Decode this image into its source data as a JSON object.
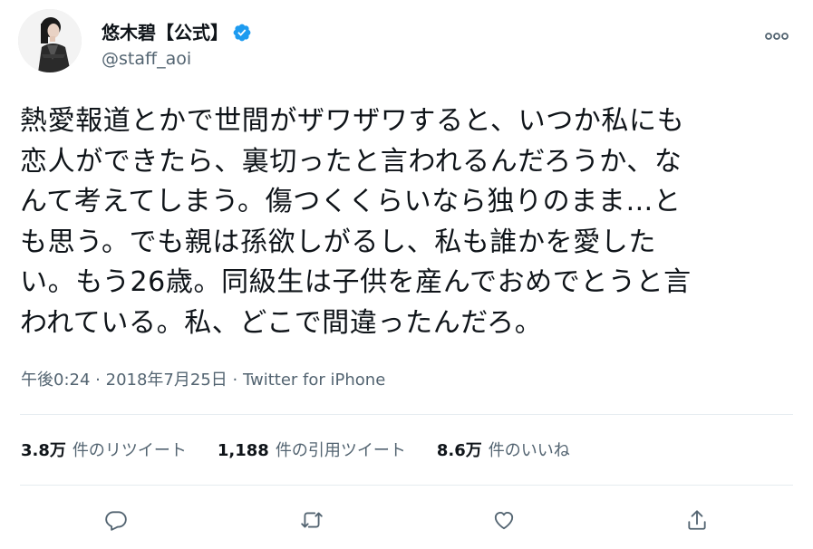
{
  "user": {
    "display_name": "悠木碧【公式】",
    "handle": "@staff_aoi",
    "verified": true
  },
  "tweet": {
    "lines": [
      "熱愛報道とかで世間がザワザワすると、いつか私にも",
      "恋人ができたら、裏切ったと言われるんだろうか、な",
      "んて考えてしまう。傷つくくらいなら独りのまま…と",
      "も思う。でも親は孫欲しがるし、私も誰かを愛した",
      "い。もう26歳。同級生は子供を産んでおめでとうと言",
      "われている。私、どこで間違ったんだろ。"
    ],
    "time": "午後0:24",
    "separator": "·",
    "date": "2018年7月25日",
    "source": "Twitter for iPhone"
  },
  "stats": {
    "retweets_value": "3.8万",
    "retweets_label": "件のリツイート",
    "quotes_value": "1,188",
    "quotes_label": "件の引用ツイート",
    "likes_value": "8.6万",
    "likes_label": "件のいいね"
  },
  "icons": {
    "verified": "verified-badge-icon",
    "more": "more-dots-icon",
    "reply": "reply-icon",
    "retweet": "retweet-icon",
    "like": "like-icon",
    "share": "share-icon"
  },
  "colors": {
    "text": "#0f1419",
    "secondary": "#536471",
    "verified": "#1d9bf0",
    "divider": "#e6ecf0"
  }
}
